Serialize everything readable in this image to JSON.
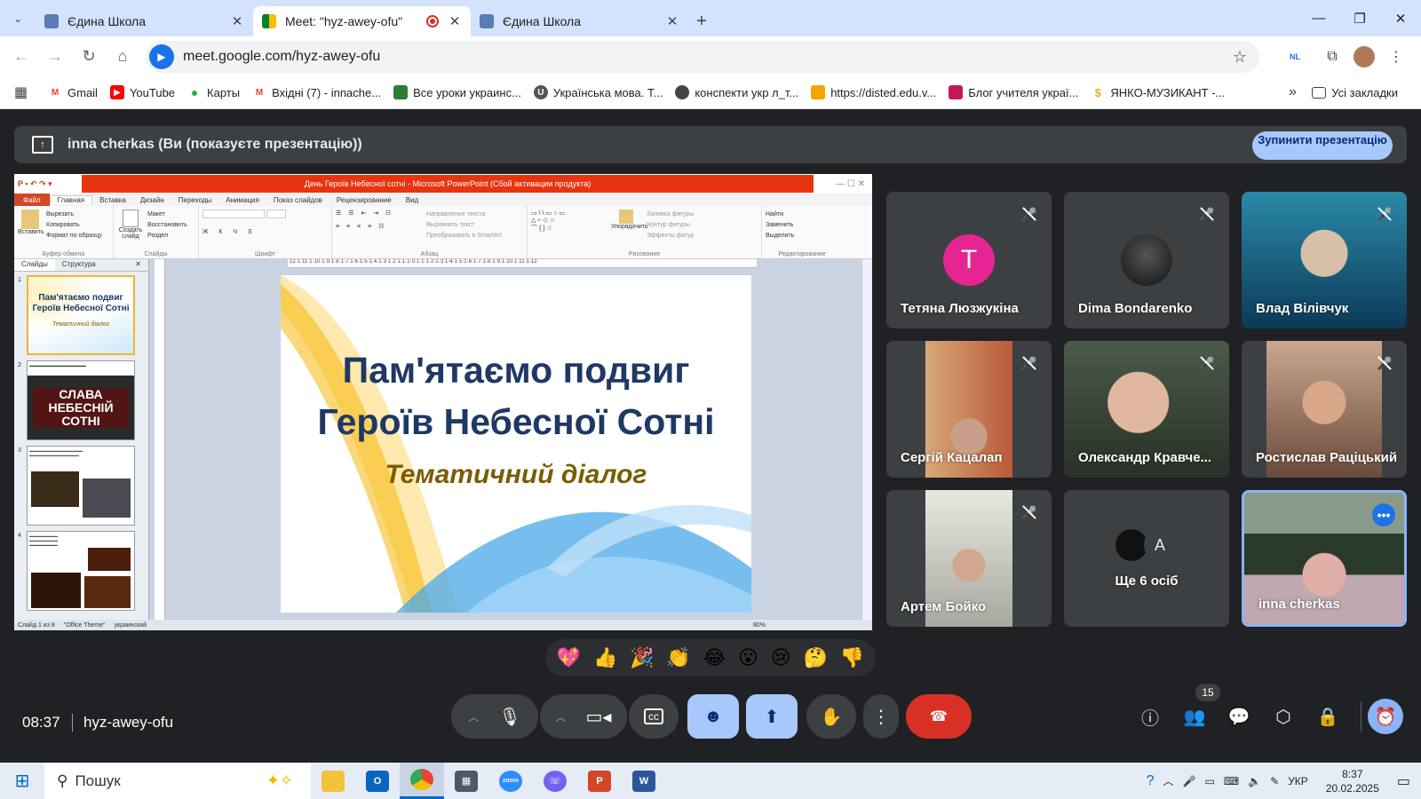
{
  "browser": {
    "tabs": [
      {
        "title": "Єдина Школа",
        "active": false
      },
      {
        "title": "Meet: \"hyz-awey-ofu\"",
        "active": true
      },
      {
        "title": "Єдина Школа",
        "active": false
      }
    ],
    "url": "meet.google.com/hyz-awey-ofu",
    "profile_badge": "NL",
    "bookmarks": [
      {
        "label": "Gmail",
        "icon": "gmail-icon",
        "color": "#ea4335"
      },
      {
        "label": "YouTube",
        "icon": "youtube-icon",
        "color": "#ff0000"
      },
      {
        "label": "Карты",
        "icon": "maps-icon",
        "color": "#34a853"
      },
      {
        "label": "Вхідні (7) - innache...",
        "icon": "gmail-icon",
        "color": "#ea4335"
      },
      {
        "label": "Все уроки украинс...",
        "icon": "book-icon",
        "color": "#2e7d32"
      },
      {
        "label": "Українська мова. Т...",
        "icon": "u-icon",
        "color": "#555555"
      },
      {
        "label": "конспекти укр л_т...",
        "icon": "globe-icon",
        "color": "#444444"
      },
      {
        "label": "https://disted.edu.v...",
        "icon": "edu-icon",
        "color": "#f4a300"
      },
      {
        "label": "Блог учителя украї...",
        "icon": "blog-icon",
        "color": "#c2185b"
      },
      {
        "label": "ЯНКО-МУЗИКАНТ -...",
        "icon": "dollar-icon",
        "color": "#f9a825"
      }
    ],
    "all_bookmarks": "Усі закладки"
  },
  "meet": {
    "presenting_banner": "inna cherkas (Ви (показуєте презентацію))",
    "stop_button": "Зупинити презентацію",
    "time": "08:37",
    "meeting_code": "hyz-awey-ofu",
    "participants_count": "15",
    "reactions": [
      "💖",
      "👍",
      "🎉",
      "👏",
      "😂",
      "😮",
      "😢",
      "🤔",
      "👎"
    ],
    "tiles": [
      {
        "name": "Тетяна Люзжукіна",
        "avatar_letter": "T",
        "avatar_color": "#e52592",
        "muted": true
      },
      {
        "name": "Dima Bondarenko",
        "avatar_letter": "",
        "avatar_color": "#1f1f1f",
        "muted": true
      },
      {
        "name": "Влад Вілівчук",
        "muted": true
      },
      {
        "name": "Сергій Кацалап",
        "muted": true
      },
      {
        "name": "Олександр Кравче...",
        "muted": true
      },
      {
        "name": "Ростислав Раціцький",
        "muted": true
      },
      {
        "name": "Артем Бойко",
        "muted": true
      },
      {
        "name": "Ще 6 осіб",
        "avatar_letter": "A"
      },
      {
        "name": "inna cherkas",
        "active": true
      }
    ]
  },
  "ppt": {
    "window_title": "День Героїв Небесної сотні - Microsoft PowerPoint (Сбой активации продукта)",
    "ribbon_tabs": [
      "Файл",
      "Главная",
      "Вставка",
      "Дизайн",
      "Переходы",
      "Анимация",
      "Показ слайдов",
      "Рецензирование",
      "Вид"
    ],
    "ribbon_groups": [
      {
        "label": "Буфер обмена",
        "items": [
          "Вырезать",
          "Копировать",
          "Формат по образцу"
        ],
        "big": "Вставить"
      },
      {
        "label": "Слайды",
        "items": [
          "Макет",
          "Восстановить",
          "Раздел"
        ],
        "big": "Создать слайд"
      },
      {
        "label": "Шрифт",
        "items": []
      },
      {
        "label": "Абзац",
        "items": [
          "Направление текста",
          "Выровнять текст",
          "Преобразовать в SmartArt"
        ]
      },
      {
        "label": "Рисование",
        "items": [
          "Заливка фигуры",
          "Контур фигуры",
          "Эффекты фигур"
        ],
        "big": "Упорядочить"
      },
      {
        "label": "Редактирование",
        "items": [
          "Найти",
          "Заменить",
          "Выделить"
        ]
      }
    ],
    "pane_tabs": [
      "Слайды",
      "Структура"
    ],
    "slide_numbers": [
      "1",
      "2",
      "3",
      "4"
    ],
    "thumb_title": "Пам'ятаємо подвиг Героїв Небесної Сотні",
    "thumb_sub": "Тематичний діалог",
    "thumb2_text": "СЛАВА НЕБЕСНІЙ СОТНІ",
    "slide_title_line1": "Пам'ятаємо подвиг",
    "slide_title_line2": "Героїв Небесної Сотні",
    "slide_subtitle": "Тематичний діалог",
    "status": [
      "Слайд 1 из 8",
      "\"Office Theme\"",
      "украинский"
    ],
    "zoom": "80%"
  },
  "taskbar": {
    "search": "Пошук",
    "lang": "УКР",
    "time": "8:37",
    "date": "20.02.2025"
  }
}
